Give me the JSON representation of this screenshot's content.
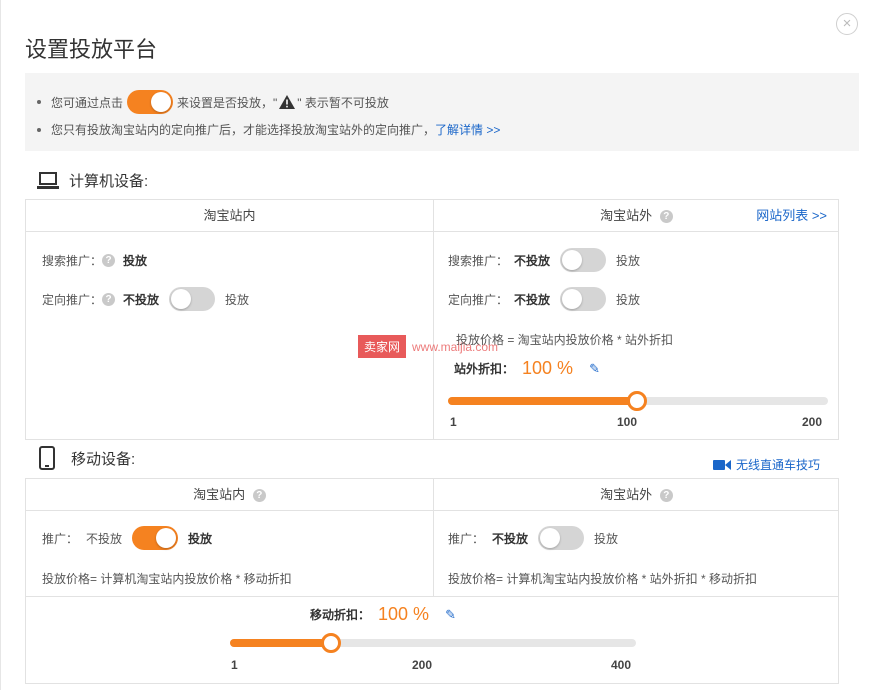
{
  "dialog": {
    "title": "设置投放平台",
    "close_symbol": "×"
  },
  "notice": {
    "line1_before": "您可通过点击",
    "line1_after": "来设置是否投放，\"",
    "line1_end": "\" 表示暂不可投放",
    "line2_text": "您只有投放淘宝站内的定向推广后，才能选择投放淘宝站外的定向推广，",
    "line2_link": "了解详情 >>"
  },
  "computer": {
    "heading": "计算机设备:",
    "icon": "laptop-icon",
    "inside": {
      "header": "淘宝站内",
      "search_label": "搜索推广：",
      "search_status": "投放",
      "target_label": "定向推广：",
      "target_off_label": "不投放",
      "target_on_label": "投放",
      "target_toggle": "off"
    },
    "outside": {
      "header": "淘宝站外",
      "site_list_link": "网站列表 >>",
      "search_label": "搜索推广：",
      "search_off_label": "不投放",
      "search_on_label": "投放",
      "search_toggle": "off",
      "target_label": "定向推广：",
      "target_off_label": "不投放",
      "target_on_label": "投放",
      "target_toggle": "off",
      "formula": "投放价格 = 淘宝站内投放价格 * 站外折扣",
      "discount_label": "站外折扣：",
      "discount_value": "100 %",
      "slider": {
        "min": "1",
        "mid": "100",
        "max": "200",
        "value": 100
      }
    }
  },
  "mobile": {
    "heading": "移动设备:",
    "icon": "phone-icon",
    "video_tip": "无线直通车技巧",
    "inside": {
      "header": "淘宝站内",
      "promo_label": "推广：",
      "off_label": "不投放",
      "on_label": "投放",
      "toggle": "on",
      "formula": "投放价格= 计算机淘宝站内投放价格 * 移动折扣"
    },
    "outside": {
      "header": "淘宝站外",
      "promo_label": "推广：",
      "off_label": "不投放",
      "on_label": "投放",
      "toggle": "off",
      "formula": "投放价格= 计算机淘宝站内投放价格 * 站外折扣 * 移动折扣"
    },
    "discount_label": "移动折扣：",
    "discount_value": "100 %",
    "slider": {
      "min": "1",
      "mid": "200",
      "max": "400",
      "value": 100
    }
  },
  "watermark": {
    "badge": "卖家网",
    "url": "www.maijia.com"
  },
  "colors": {
    "accent": "#f58220",
    "link": "#1a66c9",
    "toggle_off": "#d5d5d5"
  }
}
